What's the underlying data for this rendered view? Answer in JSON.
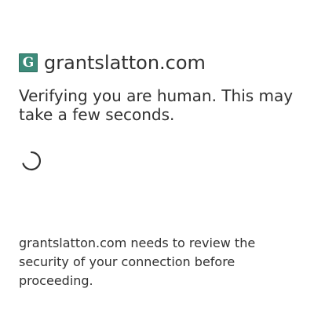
{
  "site": {
    "favicon_letter": "G",
    "favicon_icon": "grantslatton-favicon-icon",
    "name": "grantslatton.com"
  },
  "main": {
    "heading": "Verifying you are human. This may take a few seconds.",
    "spinner_icon": "loading-spinner-icon",
    "review_text": "grantslatton.com needs to review the security of your connection before proceeding."
  },
  "colors": {
    "text": "#313131",
    "favicon_bg": "#3d8b7a",
    "spinner": "#313131"
  }
}
